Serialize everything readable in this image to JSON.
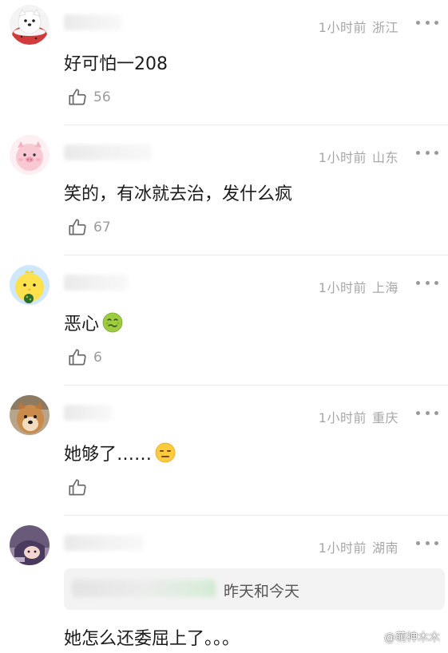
{
  "comments": [
    {
      "time": "1小时前",
      "location": "浙江",
      "text": "好可怕一208",
      "likes": "56",
      "avatar_icon": "white-dog-avatar-icon"
    },
    {
      "time": "1小时前",
      "location": "山东",
      "text": "笑的，有冰就去治，发什么疯",
      "likes": "67",
      "avatar_icon": "pink-pig-avatar-icon"
    },
    {
      "time": "1小时前",
      "location": "上海",
      "text": "恶心",
      "emoji": "nauseated-face-emoji",
      "likes": "6",
      "avatar_icon": "yellow-chick-avatar-icon"
    },
    {
      "time": "1小时前",
      "location": "重庆",
      "text": "她够了……",
      "emoji": "expressionless-face-emoji",
      "likes": "",
      "avatar_icon": "shiba-dog-avatar-icon"
    },
    {
      "time": "1小时前",
      "location": "湖南",
      "quote_text": "昨天和今天",
      "text": "她怎么还委屈上了。。。",
      "avatar_icon": "anime-avatar-icon"
    }
  ],
  "watermark": {
    "text": "@萌神木木"
  },
  "colors": {
    "meta": "#a7a7a7",
    "text": "#1c1c1c",
    "divider": "#ececec",
    "quote_bg": "#f3f3f3"
  }
}
